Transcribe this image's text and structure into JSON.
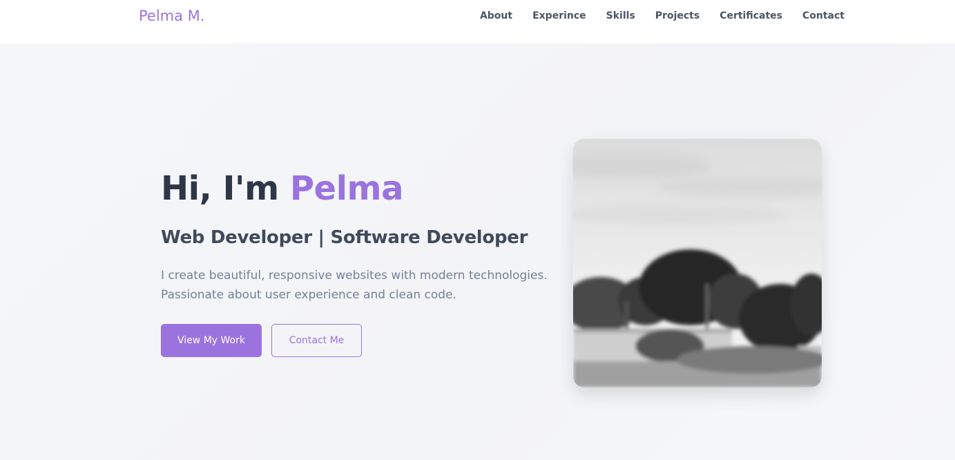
{
  "brand": {
    "name": "Pelma M."
  },
  "nav": {
    "items": [
      {
        "label": "About"
      },
      {
        "label": "Experince"
      },
      {
        "label": "Skills"
      },
      {
        "label": "Projects"
      },
      {
        "label": "Certificates"
      },
      {
        "label": "Contact"
      }
    ]
  },
  "hero": {
    "greeting": "Hi, I'm ",
    "name": "Pelma",
    "subtitle": "Web Developer | Software Developer",
    "description_line1": "I create beautiful, responsive websites with modern technologies.",
    "description_line2": "Passionate about user experience and clean code.",
    "primary_button": "View My Work",
    "secondary_button": "Contact Me"
  },
  "colors": {
    "accent": "#9b73df",
    "heading": "#2d3748",
    "body_text": "#718096",
    "background": "#f5f6f8"
  }
}
